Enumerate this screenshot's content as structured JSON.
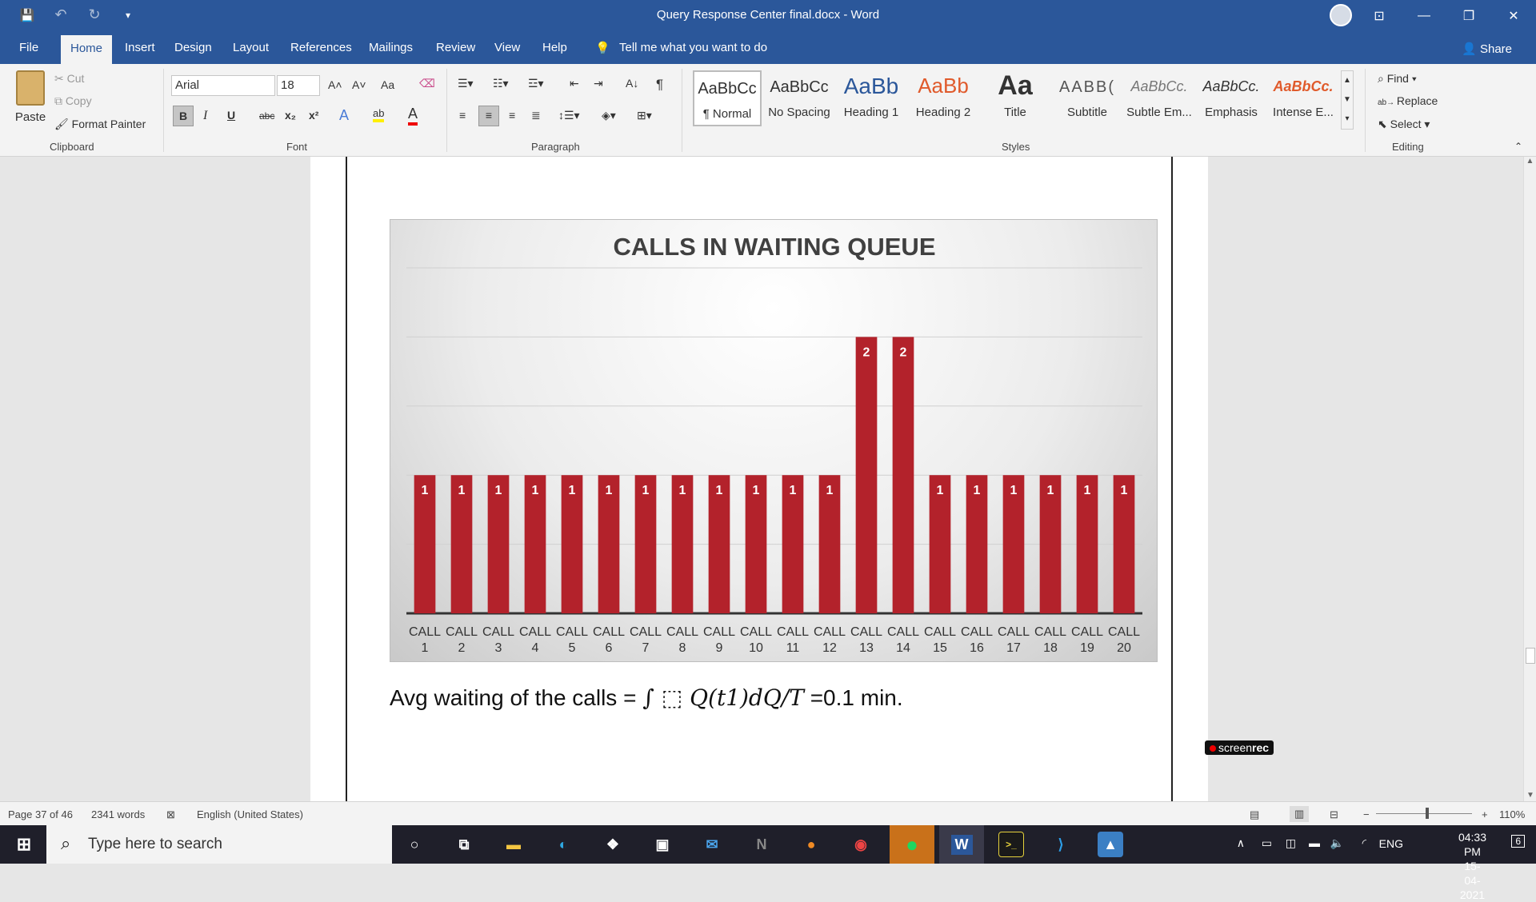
{
  "window": {
    "title": "Query Response Center final.docx  -  Word",
    "minimize": "—",
    "restore": "❐",
    "close": "✕",
    "ribbon_display": "⊡"
  },
  "qat": {
    "save": "💾",
    "undo": "↶",
    "redo": "↻",
    "customize": "▾"
  },
  "tabs": [
    "File",
    "Home",
    "Insert",
    "Design",
    "Layout",
    "References",
    "Mailings",
    "Review",
    "View",
    "Help"
  ],
  "tell_me": "Tell me what you want to do",
  "share": "Share",
  "ribbon": {
    "clipboard": {
      "label": "Clipboard",
      "paste": "Paste",
      "cut": "Cut",
      "copy": "Copy",
      "format_painter": "Format Painter"
    },
    "font": {
      "label": "Font",
      "name": "Arial",
      "size": "18",
      "bold": "B",
      "italic": "I",
      "underline": "U",
      "strike": "abc",
      "sub": "x₂",
      "sup": "x²",
      "grow": "A˄",
      "shrink": "A˅",
      "case": "Aa",
      "color": "A"
    },
    "paragraph": {
      "label": "Paragraph",
      "pilcrow": "¶",
      "sort": "A↓"
    },
    "styles": {
      "label": "Styles",
      "items": [
        {
          "preview": "AaBbCc",
          "name": "¶ Normal"
        },
        {
          "preview": "AaBbCc",
          "name": "No Spacing"
        },
        {
          "preview": "AaBb",
          "name": "Heading 1"
        },
        {
          "preview": "AaBb",
          "name": "Heading 2"
        },
        {
          "preview": "Aa",
          "name": "Title"
        },
        {
          "preview": "AABB(",
          "name": "Subtitle"
        },
        {
          "preview": "AaBbCc.",
          "name": "Subtle Em..."
        },
        {
          "preview": "AaBbCc.",
          "name": "Emphasis"
        },
        {
          "preview": "AaBbCc.",
          "name": "Intense E..."
        }
      ]
    },
    "editing": {
      "label": "Editing",
      "find": "Find",
      "replace": "Replace",
      "select": "Select"
    }
  },
  "chart_data": {
    "type": "bar",
    "title": "CALLS IN WAITING QUEUE",
    "categories": [
      "CALL 1",
      "CALL 2",
      "CALL 3",
      "CALL 4",
      "CALL 5",
      "CALL 6",
      "CALL 7",
      "CALL 8",
      "CALL 9",
      "CALL 10",
      "CALL 11",
      "CALL 12",
      "CALL 13",
      "CALL 14",
      "CALL 15",
      "CALL 16",
      "CALL 17",
      "CALL 18",
      "CALL 19",
      "CALL 20"
    ],
    "values": [
      1,
      1,
      1,
      1,
      1,
      1,
      1,
      1,
      1,
      1,
      1,
      1,
      2,
      2,
      1,
      1,
      1,
      1,
      1,
      1
    ],
    "ylim": [
      0,
      2.5
    ],
    "grid": true,
    "data_labels": true,
    "bar_color": "#b3222b",
    "xlabel": "",
    "ylabel": ""
  },
  "equation": {
    "prefix": "Avg waiting of the calls = ",
    "math": "∫ ⬚ Q(t1)dQ/T",
    "suffix": " =0.1 min."
  },
  "watermark": {
    "screen": "screen",
    "rec": "rec"
  },
  "status": {
    "page": "Page 37 of 46",
    "words": "2341 words",
    "language": "English (United States)",
    "zoom": "110%"
  },
  "taskbar": {
    "search_placeholder": "Type here to search",
    "lang": "ENG",
    "time": "04:33 PM",
    "date": "15-04-2021",
    "notifications": "6"
  }
}
